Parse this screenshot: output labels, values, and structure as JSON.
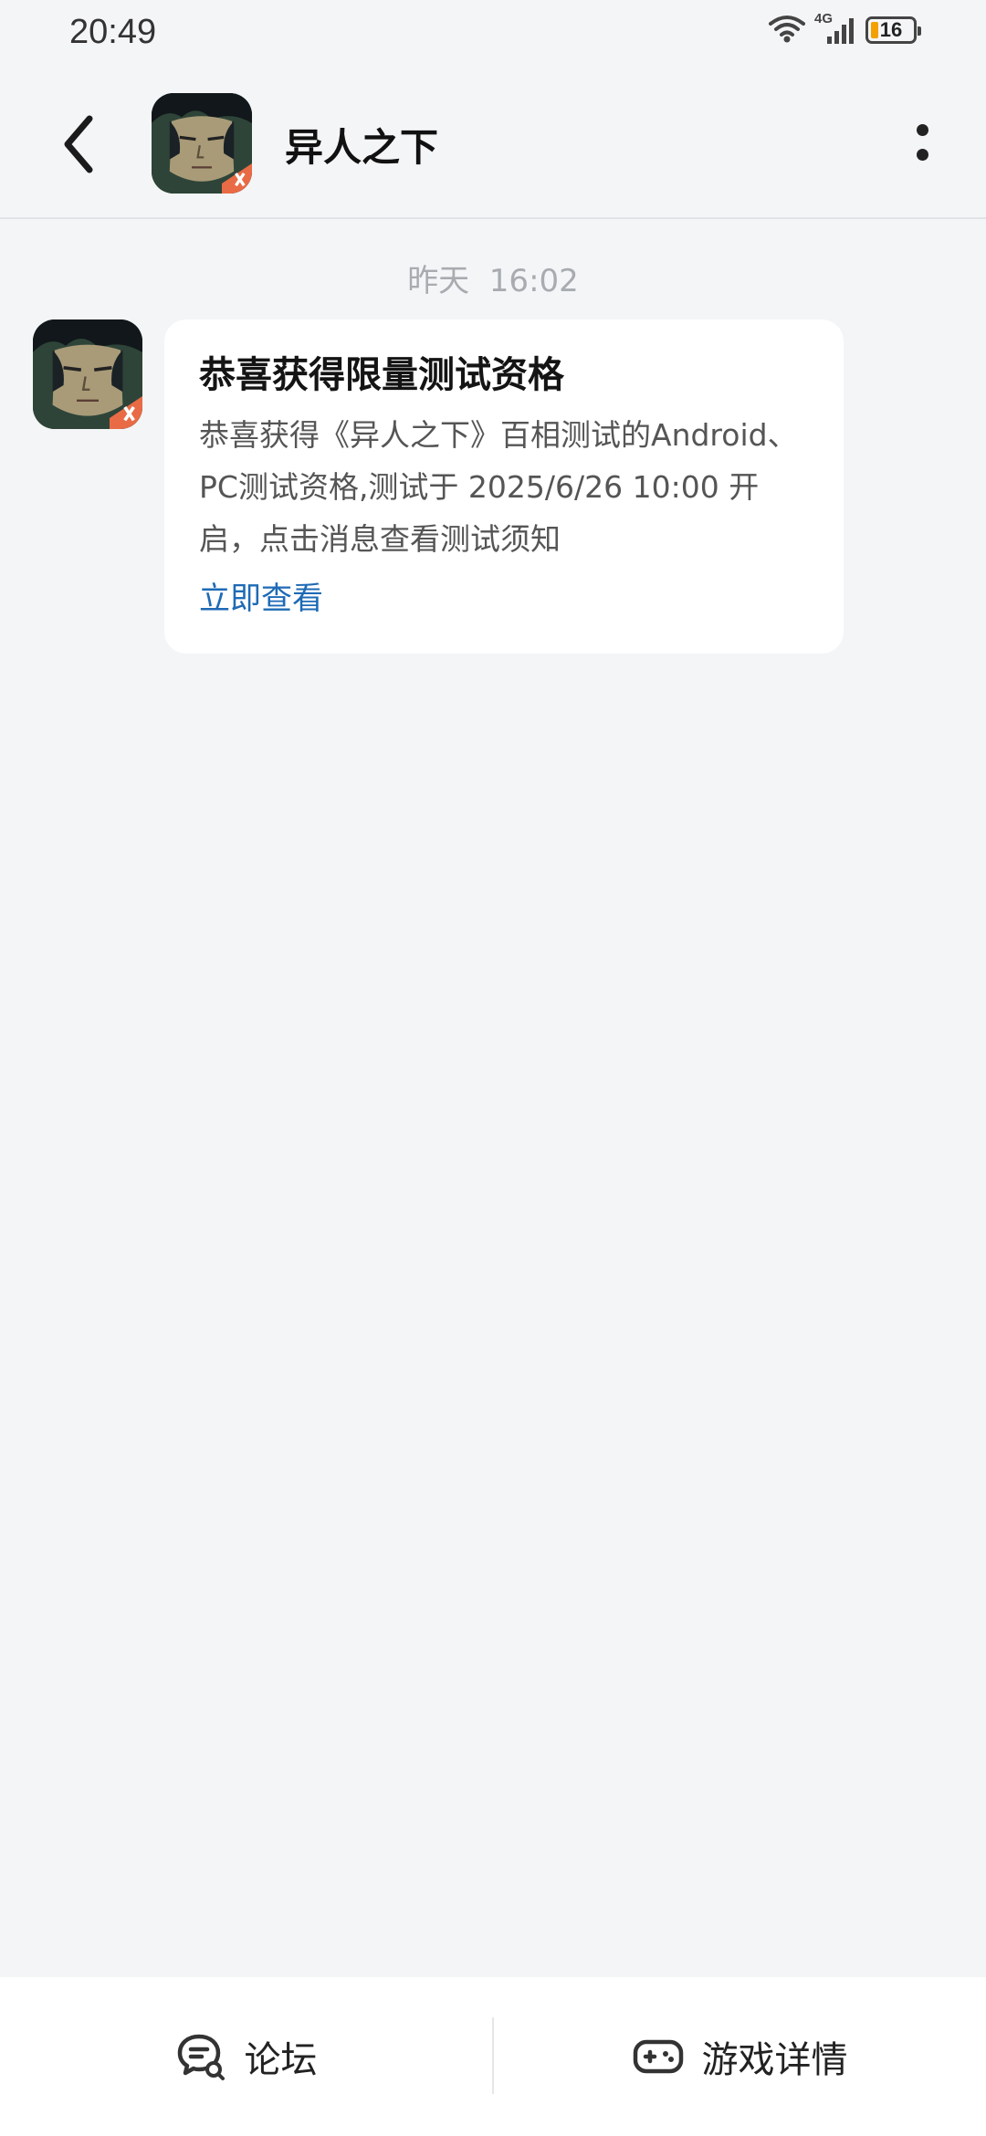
{
  "status_bar": {
    "time": "20:49",
    "network": "4G",
    "battery_level": "16",
    "icons": [
      "wifi-icon",
      "signal-icon",
      "battery-icon"
    ]
  },
  "header": {
    "title": "异人之下",
    "icons": [
      "back-arrow-icon",
      "more-vertical-icon"
    ]
  },
  "chat": {
    "timestamp": "昨天  16:02",
    "message": {
      "title": "恭喜获得限量测试资格",
      "body": "恭喜获得《异人之下》百相测试的Android、PC测试资格,测试于 2025/6/26 10:00 开启，点击消息查看测试须知",
      "link": "立即查看"
    }
  },
  "bottom_bar": {
    "forum_label": "论坛",
    "game_detail_label": "游戏详情",
    "icons": [
      "forum-chat-icon",
      "gamepad-icon"
    ]
  },
  "colors": {
    "background": "#f4f5f7",
    "card": "#ffffff",
    "link": "#1e6ab6",
    "timestamp": "#a8abb0",
    "battery_accent": "#f2a100"
  }
}
